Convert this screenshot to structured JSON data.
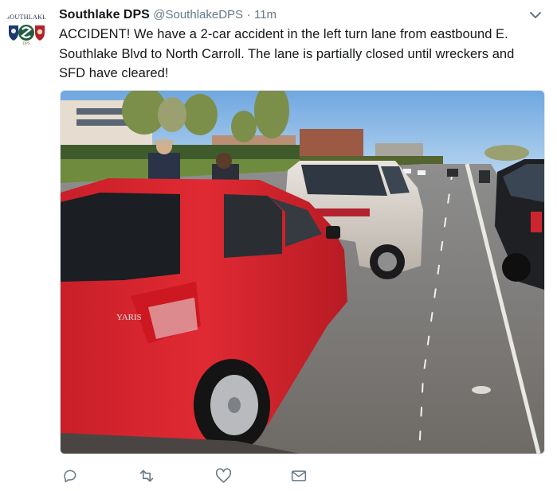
{
  "tweet": {
    "author_name": "Southlake DPS",
    "author_handle": "@SouthlakeDPS",
    "separator": "·",
    "time": "11m",
    "text_lines": [
      "ACCIDENT!  We have a 2-car accident in the left turn lane from eastbound E.",
      "Southlake Blvd to North Carroll.  The lane is partially closed until wreckers and",
      "SFD have cleared!"
    ]
  },
  "avatar": {
    "wordmark": "SOUTHLAKE",
    "subtitle": "DPS"
  },
  "photo": {
    "car_badge": "YARIS"
  },
  "actions": {
    "icons": [
      "reply-icon",
      "retweet-icon",
      "like-icon",
      "direct-message-icon"
    ]
  },
  "colors": {
    "icon_gray": "#657786",
    "text": "#14171a",
    "muted": "#657786",
    "border": "#e1e8ed",
    "car_red": "#d8242f"
  }
}
